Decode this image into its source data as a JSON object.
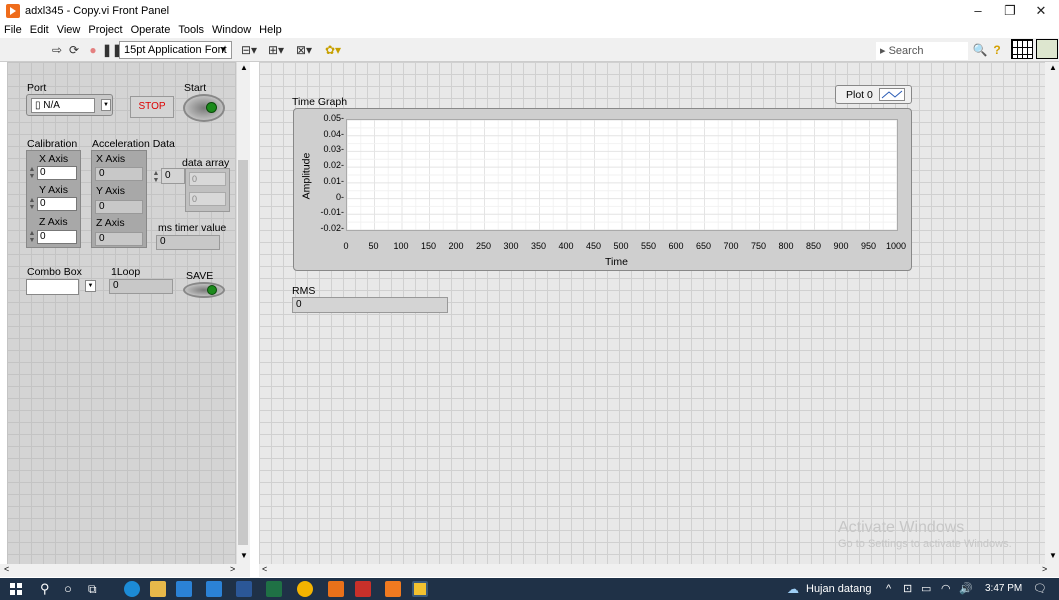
{
  "window": {
    "title": "adxl345 - Copy.vi Front Panel"
  },
  "menu": [
    "File",
    "Edit",
    "View",
    "Project",
    "Operate",
    "Tools",
    "Window",
    "Help"
  ],
  "toolbar": {
    "font": "15pt Application Font",
    "search_placeholder": "Search"
  },
  "controls": {
    "port_label": "Port",
    "port_value": "N/A",
    "start_label": "Start",
    "stop_label": "STOP",
    "calibration_label": "Calibration",
    "cal_x_label": "X Axis",
    "cal_x_value": "0",
    "cal_y_label": "Y Axis",
    "cal_y_value": "0",
    "cal_z_label": "Z Axis",
    "cal_z_value": "0",
    "accel_label": "Acceleration Data",
    "acc_x_label": "X Axis",
    "acc_x_value": "0",
    "acc_y_label": "Y Axis",
    "acc_y_value": "0",
    "acc_z_label": "Z Axis",
    "acc_z_value": "0",
    "data_array_label": "data array",
    "data_array_index": "0",
    "data_array_cells": [
      "0",
      "0"
    ],
    "ms_timer_label": "ms timer value",
    "ms_timer_value": "0",
    "combo_label": "Combo Box",
    "combo_value": "",
    "loop_label": "1Loop",
    "loop_value": "0",
    "save_label": "SAVE"
  },
  "graph": {
    "title": "Time Graph",
    "legend": "Plot 0",
    "xlabel": "Time",
    "ylabel": "Amplitude",
    "yticks": [
      "0.05",
      "0.04",
      "0.03",
      "0.02",
      "0.01",
      "0",
      "-0.01",
      "-0.02"
    ],
    "xticks": [
      "0",
      "50",
      "100",
      "150",
      "200",
      "250",
      "300",
      "350",
      "400",
      "450",
      "500",
      "550",
      "600",
      "650",
      "700",
      "750",
      "800",
      "850",
      "900",
      "950",
      "1000"
    ]
  },
  "rms": {
    "label": "RMS",
    "value": "0"
  },
  "watermark": {
    "line1": "Activate Windows",
    "line2": "Go to Settings to activate Windows."
  },
  "taskbar": {
    "weather": "Hujan datang",
    "time": "3:47 PM"
  }
}
